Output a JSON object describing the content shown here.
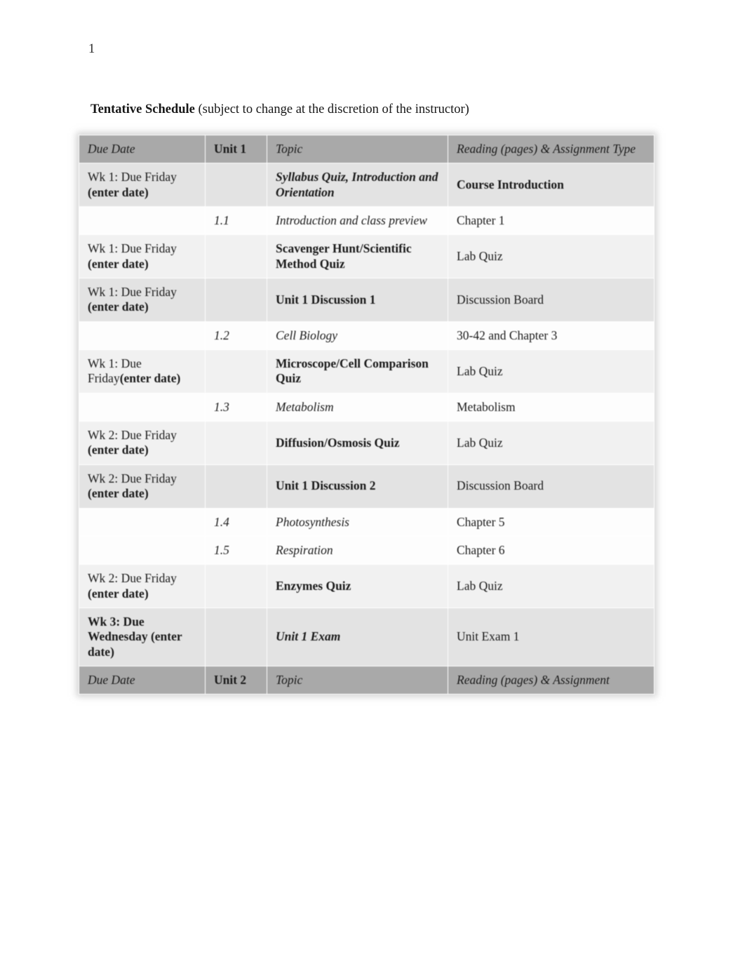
{
  "document": {
    "page_number": "1",
    "title_bold": "Tentative Schedule",
    "title_rest": " (subject to change at the discretion of the instructor)"
  },
  "table": {
    "columns": [
      "Due Date",
      "Unit 1",
      "Topic",
      "Reading (pages) & Assignment Type"
    ],
    "header_unit1": {
      "due_date": "Due Date",
      "unit": "Unit 1",
      "topic": "Topic",
      "reading": "Reading (pages) & Assignment Type"
    },
    "header_unit2": {
      "due_date": "Due Date",
      "unit": "Unit 2",
      "topic": "Topic",
      "reading": "Reading (pages) & Assignment"
    },
    "rows": [
      {
        "due_plain": "Wk 1: Due Friday ",
        "due_bold": "(enter date)",
        "unit": "",
        "topic": "Syllabus Quiz, Introduction and Orientation",
        "reading": "Course Introduction"
      },
      {
        "due_plain": "",
        "due_bold": "",
        "unit": "1.1",
        "topic": "Introduction and class preview",
        "reading": "Chapter 1"
      },
      {
        "due_plain": "Wk 1: Due Friday ",
        "due_bold": "(enter date)",
        "unit": "",
        "topic": "Scavenger Hunt/Scientific Method Quiz",
        "reading": "Lab Quiz"
      },
      {
        "due_plain": "Wk 1: Due Friday ",
        "due_bold": "(enter date)",
        "unit": "",
        "topic": "Unit 1 Discussion 1",
        "reading": "Discussion Board"
      },
      {
        "due_plain": "",
        "due_bold": "",
        "unit": "1.2",
        "topic": "Cell Biology",
        "reading": "30-42 and Chapter 3"
      },
      {
        "due_plain": "Wk 1: Due Friday",
        "due_bold": "(enter date)",
        "unit": "",
        "topic": "Microscope/Cell Comparison Quiz",
        "reading": "Lab Quiz"
      },
      {
        "due_plain": "",
        "due_bold": "",
        "unit": "1.3",
        "topic": "Metabolism",
        "reading": "Metabolism"
      },
      {
        "due_plain": "Wk 2: Due Friday ",
        "due_bold": "(enter date)",
        "unit": "",
        "topic": "Diffusion/Osmosis Quiz",
        "reading": "Lab Quiz"
      },
      {
        "due_plain": "Wk 2: Due Friday ",
        "due_bold": "(enter date)",
        "unit": "",
        "topic": "Unit 1 Discussion 2",
        "reading": "Discussion Board"
      },
      {
        "due_plain": "",
        "due_bold": "",
        "unit": "1.4",
        "topic": "Photosynthesis",
        "reading": "Chapter 5"
      },
      {
        "due_plain": "",
        "due_bold": "",
        "unit": "1.5",
        "topic": "Respiration",
        "reading": "Chapter 6"
      },
      {
        "due_plain": "Wk 2: Due Friday ",
        "due_bold": "(enter date)",
        "unit": "",
        "topic": "Enzymes Quiz",
        "reading": "Lab Quiz"
      },
      {
        "due_plain": "",
        "due_bold": "Wk 3: Due Wednesday (enter date)",
        "unit": "",
        "topic": "Unit 1 Exam",
        "reading": "Unit Exam 1"
      }
    ]
  },
  "colors": {
    "header_gray": "#a9a9a9",
    "shade_gray": "#e3e3e3",
    "light_gray": "#f1f1f1",
    "white": "#fdfdfd",
    "text": "#1a1a1a"
  }
}
